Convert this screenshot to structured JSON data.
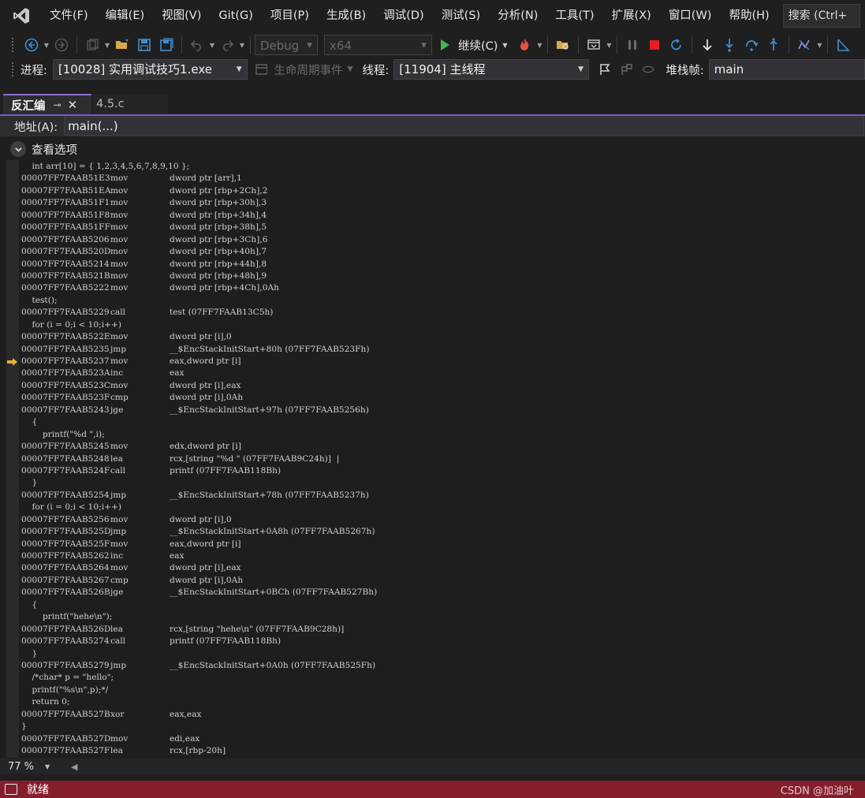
{
  "menu": {
    "items": [
      "文件(F)",
      "编辑(E)",
      "视图(V)",
      "Git(G)",
      "项目(P)",
      "生成(B)",
      "调试(D)",
      "测试(S)",
      "分析(N)",
      "工具(T)",
      "扩展(X)",
      "窗口(W)",
      "帮助(H)"
    ],
    "search": "搜索 (Ctrl+"
  },
  "toolbar": {
    "config": "Debug",
    "platform": "x64",
    "continue_label": "继续(C)"
  },
  "debug_location": {
    "process_label": "进程:",
    "process_value": "[10028] 实用调试技巧1.exe",
    "lifecycle_label": "生命周期事件",
    "thread_label": "线程:",
    "thread_value": "[11904] 主线程",
    "stackframe_label": "堆栈帧:",
    "stackframe_value": "main"
  },
  "tabs": [
    {
      "label": "反汇编",
      "active": true
    },
    {
      "label": "4.5.c",
      "active": false
    }
  ],
  "address": {
    "label": "地址(A):",
    "value": "main(...)"
  },
  "view_options_label": "查看选项",
  "code": [
    {
      "t": "s",
      "text": "    int arr[10] = { 1,2,3,4,5,6,7,8,9,10 };"
    },
    {
      "t": "a",
      "addr": "00007FF7FAAB51E3",
      "mn": "mov",
      "op": "dword ptr [arr],1"
    },
    {
      "t": "a",
      "addr": "00007FF7FAAB51EA",
      "mn": "mov",
      "op": "dword ptr [rbp+2Ch],2"
    },
    {
      "t": "a",
      "addr": "00007FF7FAAB51F1",
      "mn": "mov",
      "op": "dword ptr [rbp+30h],3"
    },
    {
      "t": "a",
      "addr": "00007FF7FAAB51F8",
      "mn": "mov",
      "op": "dword ptr [rbp+34h],4"
    },
    {
      "t": "a",
      "addr": "00007FF7FAAB51FF",
      "mn": "mov",
      "op": "dword ptr [rbp+38h],5"
    },
    {
      "t": "a",
      "addr": "00007FF7FAAB5206",
      "mn": "mov",
      "op": "dword ptr [rbp+3Ch],6"
    },
    {
      "t": "a",
      "addr": "00007FF7FAAB520D",
      "mn": "mov",
      "op": "dword ptr [rbp+40h],7"
    },
    {
      "t": "a",
      "addr": "00007FF7FAAB5214",
      "mn": "mov",
      "op": "dword ptr [rbp+44h],8"
    },
    {
      "t": "a",
      "addr": "00007FF7FAAB521B",
      "mn": "mov",
      "op": "dword ptr [rbp+48h],9"
    },
    {
      "t": "a",
      "addr": "00007FF7FAAB5222",
      "mn": "mov",
      "op": "dword ptr [rbp+4Ch],0Ah"
    },
    {
      "t": "s",
      "text": "    test();"
    },
    {
      "t": "a",
      "addr": "00007FF7FAAB5229",
      "mn": "call",
      "op": "test (07FF7FAAB13C5h)"
    },
    {
      "t": "s",
      "text": "    for (i = 0;i < 10;i++)"
    },
    {
      "t": "a",
      "addr": "00007FF7FAAB522E",
      "mn": "mov",
      "op": "dword ptr [i],0"
    },
    {
      "t": "a",
      "addr": "00007FF7FAAB5235",
      "mn": "jmp",
      "op": "__$EncStackInitStart+80h (07FF7FAAB523Fh)"
    },
    {
      "t": "a",
      "addr": "00007FF7FAAB5237",
      "mn": "mov",
      "op": "eax,dword ptr [i]",
      "current": true
    },
    {
      "t": "a",
      "addr": "00007FF7FAAB523A",
      "mn": "inc",
      "op": "eax"
    },
    {
      "t": "a",
      "addr": "00007FF7FAAB523C",
      "mn": "mov",
      "op": "dword ptr [i],eax"
    },
    {
      "t": "a",
      "addr": "00007FF7FAAB523F",
      "mn": "cmp",
      "op": "dword ptr [i],0Ah"
    },
    {
      "t": "a",
      "addr": "00007FF7FAAB5243",
      "mn": "jge",
      "op": "__$EncStackInitStart+97h (07FF7FAAB5256h)"
    },
    {
      "t": "s",
      "text": "    {"
    },
    {
      "t": "s",
      "text": "        printf(\"%d \",i);"
    },
    {
      "t": "a",
      "addr": "00007FF7FAAB5245",
      "mn": "mov",
      "op": "edx,dword ptr [i]"
    },
    {
      "t": "a",
      "addr": "00007FF7FAAB5248",
      "mn": "lea",
      "op": "rcx,[string \"%d \" (07FF7FAAB9C24h)]  |"
    },
    {
      "t": "a",
      "addr": "00007FF7FAAB524F",
      "mn": "call",
      "op": "printf (07FF7FAAB118Bh)"
    },
    {
      "t": "s",
      "text": "    }"
    },
    {
      "t": "a",
      "addr": "00007FF7FAAB5254",
      "mn": "jmp",
      "op": "__$EncStackInitStart+78h (07FF7FAAB5237h)"
    },
    {
      "t": "s",
      "text": "    for (i = 0;i < 10;i++)"
    },
    {
      "t": "a",
      "addr": "00007FF7FAAB5256",
      "mn": "mov",
      "op": "dword ptr [i],0"
    },
    {
      "t": "a",
      "addr": "00007FF7FAAB525D",
      "mn": "jmp",
      "op": "__$EncStackInitStart+0A8h (07FF7FAAB5267h)"
    },
    {
      "t": "a",
      "addr": "00007FF7FAAB525F",
      "mn": "mov",
      "op": "eax,dword ptr [i]"
    },
    {
      "t": "a",
      "addr": "00007FF7FAAB5262",
      "mn": "inc",
      "op": "eax"
    },
    {
      "t": "a",
      "addr": "00007FF7FAAB5264",
      "mn": "mov",
      "op": "dword ptr [i],eax"
    },
    {
      "t": "a",
      "addr": "00007FF7FAAB5267",
      "mn": "cmp",
      "op": "dword ptr [i],0Ah"
    },
    {
      "t": "a",
      "addr": "00007FF7FAAB526B",
      "mn": "jge",
      "op": "__$EncStackInitStart+0BCh (07FF7FAAB527Bh)"
    },
    {
      "t": "s",
      "text": "    {"
    },
    {
      "t": "s",
      "text": "        printf(\"hehe\\n\");"
    },
    {
      "t": "a",
      "addr": "00007FF7FAAB526D",
      "mn": "lea",
      "op": "rcx,[string \"hehe\\n\" (07FF7FAAB9C28h)]"
    },
    {
      "t": "a",
      "addr": "00007FF7FAAB5274",
      "mn": "call",
      "op": "printf (07FF7FAAB118Bh)"
    },
    {
      "t": "s",
      "text": "    }"
    },
    {
      "t": "a",
      "addr": "00007FF7FAAB5279",
      "mn": "jmp",
      "op": "__$EncStackInitStart+0A0h (07FF7FAAB525Fh)"
    },
    {
      "t": "s",
      "text": "    /*char* p = \"hello\";"
    },
    {
      "t": "s",
      "text": "    printf(\"%s\\n\",p);*/"
    },
    {
      "t": "s",
      "text": "    return 0;"
    },
    {
      "t": "a",
      "addr": "00007FF7FAAB527B",
      "mn": "xor",
      "op": "eax,eax"
    },
    {
      "t": "s",
      "text": "}"
    },
    {
      "t": "a",
      "addr": "00007FF7FAAB527D",
      "mn": "mov",
      "op": "edi,eax"
    },
    {
      "t": "a",
      "addr": "00007FF7FAAB527F",
      "mn": "lea",
      "op": "rcx,[rbp-20h]"
    }
  ],
  "zoom": "77 %",
  "status": {
    "text": "就绪",
    "watermark": "CSDN @加油叶"
  },
  "colors": {
    "accent": "#7a5ac8",
    "status_bar": "#851e2c",
    "ip_arrow": "#e8b13a",
    "play": "#3fb950",
    "stop": "#e51c23"
  }
}
